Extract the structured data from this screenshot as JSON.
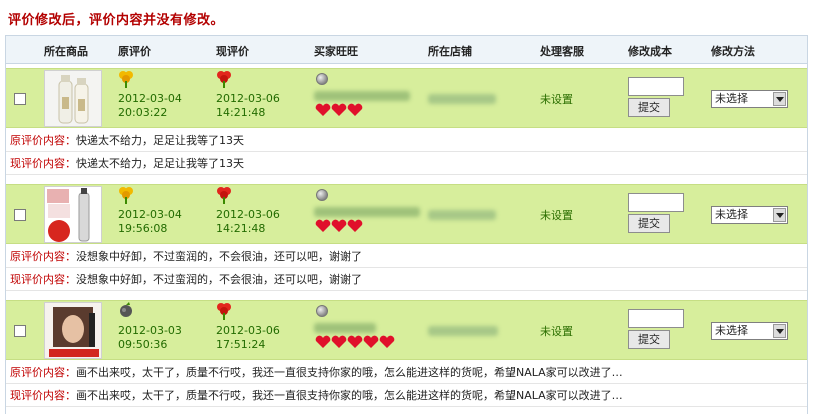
{
  "page": {
    "title": "评价修改后，评价内容并没有修改。"
  },
  "columns": [
    "所在商品",
    "原评价",
    "现评价",
    "买家旺旺",
    "所在店铺",
    "处理客服",
    "修改成本",
    "修改方法"
  ],
  "labels": {
    "original": "原评价内容：",
    "current": "现评价内容："
  },
  "rows": [
    {
      "orig_rating": "neutral",
      "orig_date": "2012-03-04",
      "orig_time": "20:03:22",
      "new_rating": "positive",
      "new_date": "2012-03-06",
      "new_time": "14:21:48",
      "hearts": 3,
      "service": "未设置",
      "submit": "提交",
      "method": "未选择",
      "original_content": "快递太不给力，足足让我等了13天",
      "current_content": "快递太不给力，足足让我等了13天"
    },
    {
      "orig_rating": "neutral",
      "orig_date": "2012-03-04",
      "orig_time": "19:56:08",
      "new_rating": "positive",
      "new_date": "2012-03-06",
      "new_time": "14:21:48",
      "hearts": 3,
      "service": "未设置",
      "submit": "提交",
      "method": "未选择",
      "original_content": "没想象中好卸，不过蛮润的，不会很油，还可以吧，谢谢了",
      "current_content": "没想象中好卸，不过蛮润的，不会很油，还可以吧，谢谢了"
    },
    {
      "orig_rating": "negative",
      "orig_date": "2012-03-03",
      "orig_time": "09:50:36",
      "new_rating": "positive",
      "new_date": "2012-03-06",
      "new_time": "17:51:24",
      "hearts": 5,
      "service": "未设置",
      "submit": "提交",
      "method": "未选择",
      "original_content": "画不出来哎，太干了，质量不行哎，我还一直很支持你家的哦，怎么能进这样的货呢，希望NALA家可以改进了…",
      "current_content": "画不出来哎，太干了，质量不行哎，我还一直很支持你家的哦，怎么能进这样的货呢，希望NALA家可以改进了…"
    }
  ]
}
